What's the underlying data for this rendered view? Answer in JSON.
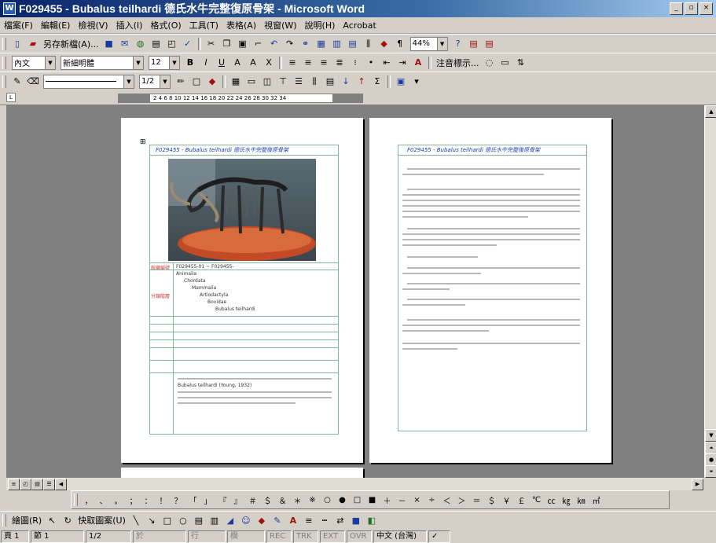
{
  "window": {
    "title": "F029455 - Bubalus teilhardi 德氏水牛完整復原骨架 - Microsoft Word",
    "app_icon": "word-doc-icon"
  },
  "window_buttons": [
    "_",
    "▫",
    "×"
  ],
  "menu": [
    "檔案(F)",
    "編輯(E)",
    "檢視(V)",
    "插入(I)",
    "格式(O)",
    "工具(T)",
    "表格(A)",
    "視窗(W)",
    "說明(H)",
    "Acrobat"
  ],
  "toolbar1": {
    "save_as_label": "另存新檔(A)...",
    "zoom": "44%"
  },
  "toolbar2": {
    "style": "內文",
    "font": "新細明體",
    "size": "12",
    "reveal_label": "注音標示..."
  },
  "toolbar3": {
    "line_size": "1/2"
  },
  "symbols": [
    "，",
    "、",
    "。",
    "；",
    "：",
    "！",
    "？",
    "「",
    "」",
    "『",
    "』",
    "＃",
    "＄",
    "＆",
    "＊",
    "※",
    "○",
    "●",
    "□",
    "■",
    "＋",
    "－",
    "×",
    "÷",
    "＜",
    "＞",
    "＝",
    "＄",
    "￥",
    "￡",
    "℃",
    "㏄",
    "㎏",
    "㎞",
    "㎡"
  ],
  "drawbar": {
    "draw_label": "繪圖(R)",
    "autoshapes_label": "快取圖案(U)"
  },
  "status": {
    "page": "頁 1",
    "section": "節 1",
    "pages": "1/2",
    "at": "於",
    "line": "行",
    "col": "欄",
    "rec": "REC",
    "trk": "TRK",
    "ext": "EXT",
    "ovr": "OVR",
    "lang": "中文 (台灣)"
  },
  "document": {
    "page1_header": "F029455 - Bubalus teilhardi 德氏水牛完整復原骨架",
    "page2_header": "F029455 - Bubalus teilhardi 德氏水牛完整復原骨架",
    "ids": "F029455-01 ~ F029455-",
    "taxonomy": [
      "Animalia",
      "Chordata",
      "Mammalia",
      "Artiodactyla",
      "Bovidae",
      "Bubalus teilhardi"
    ],
    "snippet": "Bubalus teilhardi (Young, 1932)"
  },
  "colors": {
    "title_gradient_start": "#0a246a",
    "workspace": "#808080",
    "chrome": "#d4d0c8"
  }
}
